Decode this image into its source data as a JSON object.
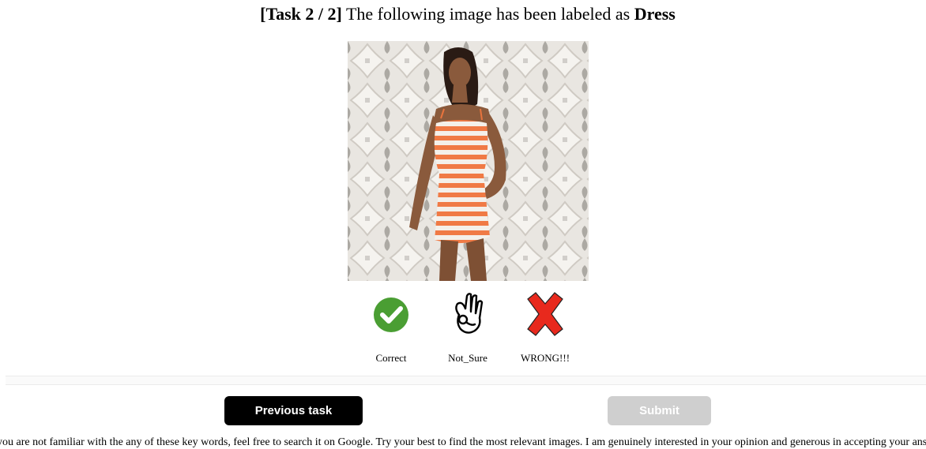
{
  "task": {
    "prefix": "[Task 2 / 2]",
    "middle": "The following image has been labeled as",
    "label": "Dress"
  },
  "image": {
    "subject": "woman in orange and white striped knit mini dress against white lattice wall"
  },
  "choices": [
    {
      "label": "Correct",
      "icon": "check-circle-icon",
      "color": "#4a9e33"
    },
    {
      "label": "Not_Sure",
      "icon": "ok-hand-icon",
      "color": "#000000"
    },
    {
      "label": "WRONG!!!",
      "icon": "red-x-icon",
      "color": "#e8291d"
    }
  ],
  "buttons": {
    "previous_label": "Previous task",
    "submit_label": "Submit",
    "submit_enabled": false
  },
  "footer": {
    "text": "you are not familiar with the any of these key words, feel free to search it on Google. Try your best to find the most relevant images. I am genuinely interested in your opinion and generous in accepting your answ"
  }
}
